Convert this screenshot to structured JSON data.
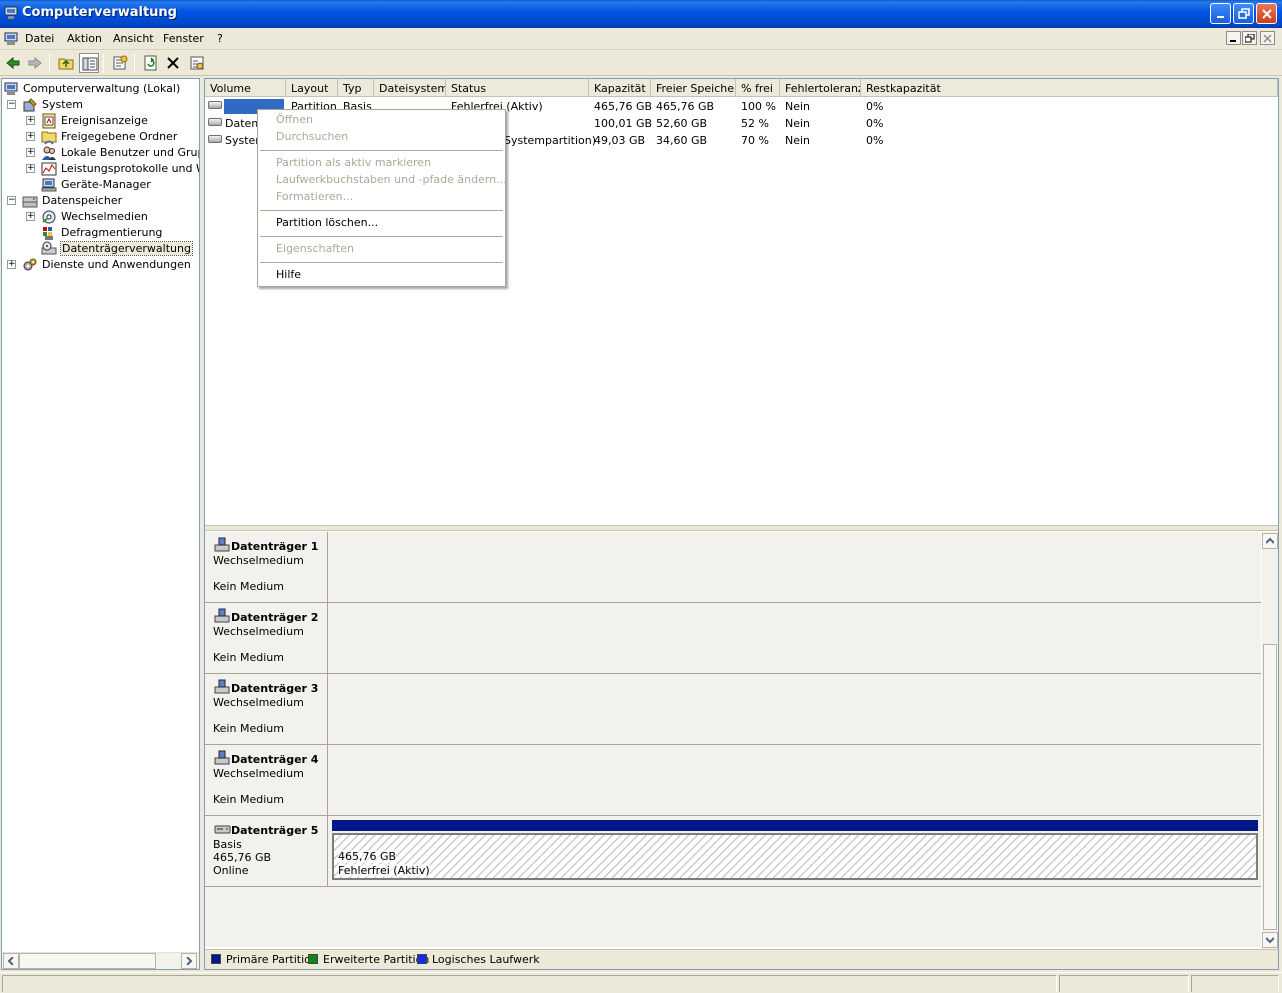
{
  "window": {
    "title": "Computerverwaltung"
  },
  "menubar": {
    "items": [
      "Datei",
      "Aktion",
      "Ansicht",
      "Fenster",
      "?"
    ]
  },
  "toolbar": {
    "icons": [
      "back-arrow-icon",
      "forward-arrow-icon",
      "up-folder-icon",
      "show-hide-tree-icon",
      "properties-icon",
      "refresh-icon",
      "delete-icon",
      "help-icon"
    ]
  },
  "tree": {
    "items": [
      {
        "label": "Computerverwaltung (Lokal)",
        "icon": "computer-icon",
        "expander": ""
      },
      {
        "label": "System",
        "icon": "system-tools-icon",
        "expander": "−"
      },
      {
        "label": "Ereignisanzeige",
        "icon": "event-viewer-icon",
        "expander": "+"
      },
      {
        "label": "Freigegebene Ordner",
        "icon": "shared-folders-icon",
        "expander": "+"
      },
      {
        "label": "Lokale Benutzer und Gruppen",
        "icon": "users-icon",
        "expander": "+"
      },
      {
        "label": "Leistungsprotokolle und Warnungen",
        "icon": "performance-icon",
        "expander": "+"
      },
      {
        "label": "Geräte-Manager",
        "icon": "device-manager-icon",
        "expander": ""
      },
      {
        "label": "Datenspeicher",
        "icon": "storage-icon",
        "expander": "−"
      },
      {
        "label": "Wechselmedien",
        "icon": "removable-media-icon",
        "expander": "+"
      },
      {
        "label": "Defragmentierung",
        "icon": "defrag-icon",
        "expander": ""
      },
      {
        "label": "Datenträgerverwaltung",
        "icon": "disk-management-icon",
        "expander": ""
      },
      {
        "label": "Dienste und Anwendungen",
        "icon": "services-icon",
        "expander": "+"
      }
    ]
  },
  "volume_list": {
    "columns": [
      "Volume",
      "Layout",
      "Typ",
      "Dateisystem",
      "Status",
      "Kapazität",
      "Freier Speicher",
      "% frei",
      "Fehlertoleranz",
      "Restkapazität"
    ],
    "rows": [
      {
        "volume": "",
        "layout": "Partition",
        "typ": "Basis",
        "dateisystem": "",
        "status": "Fehlerfrei (Aktiv)",
        "kapazitaet": "465,76 GB",
        "frei": "465,76 GB",
        "prozent": "100 %",
        "fehlertoleranz": "Nein",
        "rest": "0%"
      },
      {
        "volume": "Daten",
        "layout": "",
        "typ": "",
        "dateisystem": "",
        "status": "",
        "kapazitaet": "100,01 GB",
        "frei": "52,60 GB",
        "prozent": "52 %",
        "fehlertoleranz": "Nein",
        "rest": "0%"
      },
      {
        "volume": "System",
        "layout": "",
        "typ": "",
        "dateisystem": "",
        "status": "Systempartition)",
        "kapazitaet": "49,03 GB",
        "frei": "34,60 GB",
        "prozent": "70 %",
        "fehlertoleranz": "Nein",
        "rest": "0%"
      }
    ]
  },
  "context_menu": {
    "items": [
      {
        "label": "Öffnen",
        "enabled": false
      },
      {
        "label": "Durchsuchen",
        "enabled": false
      },
      {
        "label": "Partition als aktiv markieren",
        "enabled": false
      },
      {
        "label": "Laufwerkbuchstaben und -pfade ändern...",
        "enabled": false
      },
      {
        "label": "Formatieren...",
        "enabled": false
      },
      {
        "label": "Partition löschen...",
        "enabled": true
      },
      {
        "label": "Eigenschaften",
        "enabled": false
      },
      {
        "label": "Hilfe",
        "enabled": true
      }
    ]
  },
  "disks": [
    {
      "name": "Datenträger 1",
      "line1": "Wechselmedium",
      "line2": "",
      "line3": "Kein Medium"
    },
    {
      "name": "Datenträger 2",
      "line1": "Wechselmedium",
      "line2": "",
      "line3": "Kein Medium"
    },
    {
      "name": "Datenträger 3",
      "line1": "Wechselmedium",
      "line2": "",
      "line3": "Kein Medium"
    },
    {
      "name": "Datenträger 4",
      "line1": "Wechselmedium",
      "line2": "",
      "line3": "Kein Medium"
    },
    {
      "name": "Datenträger 5",
      "line1": "Basis",
      "line2": "465,76 GB",
      "line3": "Online",
      "partition": {
        "size": "465,76 GB",
        "status": "Fehlerfrei (Aktiv)"
      }
    }
  ],
  "legend": [
    {
      "label": "Primäre Partition",
      "color": "#00188a"
    },
    {
      "label": "Erweiterte Partition",
      "color": "#0b8a10"
    },
    {
      "label": "Logisches Laufwerk",
      "color": "#1428f0"
    }
  ],
  "colors": {
    "titlebar": "#0055e5",
    "selection": "#316ac5",
    "primary_partition": "#00188a"
  }
}
